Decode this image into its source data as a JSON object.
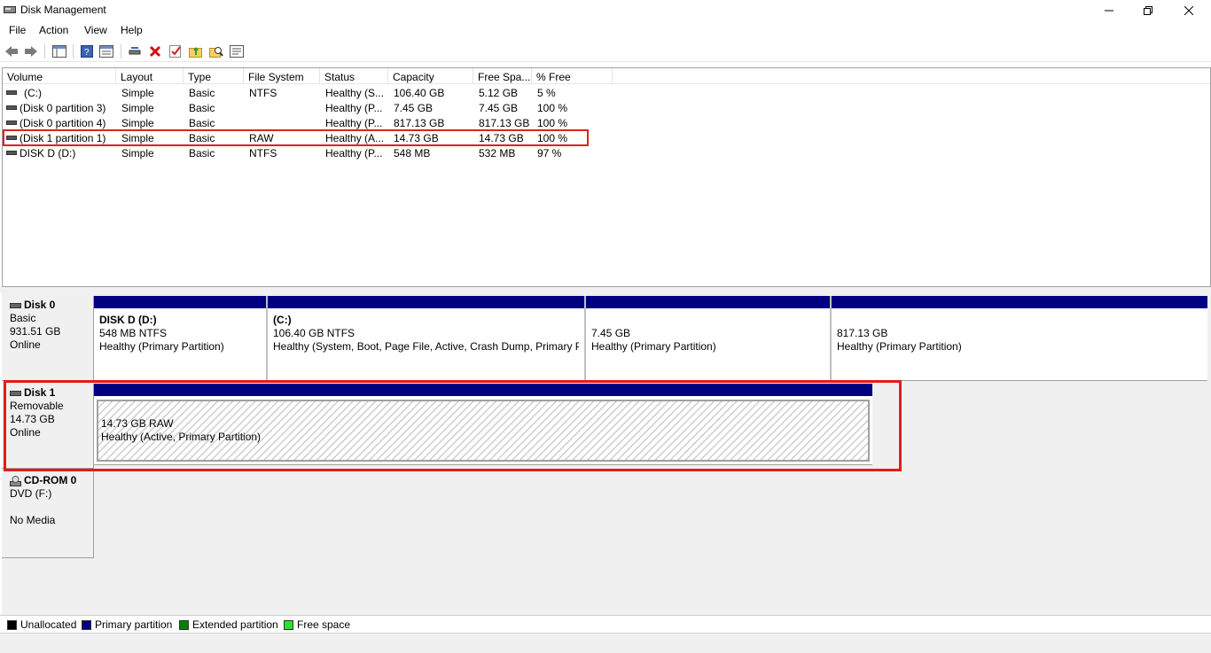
{
  "window": {
    "title": "Disk Management"
  },
  "menu": [
    "File",
    "Action",
    "View",
    "Help"
  ],
  "toolbar": {
    "buttons": [
      "back-icon",
      "forward-icon",
      "console-tree-icon",
      "help-icon",
      "properties-icon",
      "connect-icon",
      "delete-icon",
      "check-icon",
      "folder-up-icon",
      "search-icon",
      "list-icon"
    ]
  },
  "volume_table": {
    "columns": [
      "Volume",
      "Layout",
      "Type",
      "File System",
      "Status",
      "Capacity",
      "Free Spa...",
      "% Free"
    ],
    "rows": [
      [
        "(C:)",
        "Simple",
        "Basic",
        "NTFS",
        "Healthy (S...",
        "106.40 GB",
        "5.12 GB",
        "5 %"
      ],
      [
        "(Disk 0 partition 3)",
        "Simple",
        "Basic",
        "",
        "Healthy (P...",
        "7.45 GB",
        "7.45 GB",
        "100 %"
      ],
      [
        "(Disk 0 partition 4)",
        "Simple",
        "Basic",
        "",
        "Healthy (P...",
        "817.13 GB",
        "817.13 GB",
        "100 %"
      ],
      [
        "(Disk 1 partition 1)",
        "Simple",
        "Basic",
        "RAW",
        "Healthy (A...",
        "14.73 GB",
        "14.73 GB",
        "100 %"
      ],
      [
        "DISK D (D:)",
        "Simple",
        "Basic",
        "NTFS",
        "Healthy (P...",
        "548 MB",
        "532 MB",
        "97 %"
      ]
    ]
  },
  "disks": {
    "disk0": {
      "name": "Disk 0",
      "kind": "Basic",
      "size": "931.51 GB",
      "state": "Online",
      "partitions": [
        {
          "title": "DISK D  (D:)",
          "line1": "548 MB NTFS",
          "line2": "Healthy (Primary Partition)"
        },
        {
          "title": "(C:)",
          "line1": "106.40 GB NTFS",
          "line2": "Healthy (System, Boot, Page File, Active, Crash Dump, Primary Pa"
        },
        {
          "title": "",
          "line1": "7.45 GB",
          "line2": "Healthy (Primary Partition)"
        },
        {
          "title": "",
          "line1": "817.13 GB",
          "line2": "Healthy (Primary Partition)"
        }
      ]
    },
    "disk1": {
      "name": "Disk 1",
      "kind": "Removable",
      "size": "14.73 GB",
      "state": "Online",
      "partitions": [
        {
          "line1": "14.73 GB RAW",
          "line2": "Healthy (Active, Primary Partition)"
        }
      ]
    },
    "cdrom0": {
      "name": "CD-ROM 0",
      "kind": "DVD (F:)",
      "state": "No Media"
    }
  },
  "legend": [
    {
      "label": "Unallocated",
      "color": "#000000"
    },
    {
      "label": "Primary partition",
      "color": "#000080"
    },
    {
      "label": "Extended partition",
      "color": "#008000"
    },
    {
      "label": "Free space",
      "color": "#33dd33"
    }
  ],
  "colors": {
    "highlight": "#e21c1c",
    "primary_partition": "#000080"
  }
}
